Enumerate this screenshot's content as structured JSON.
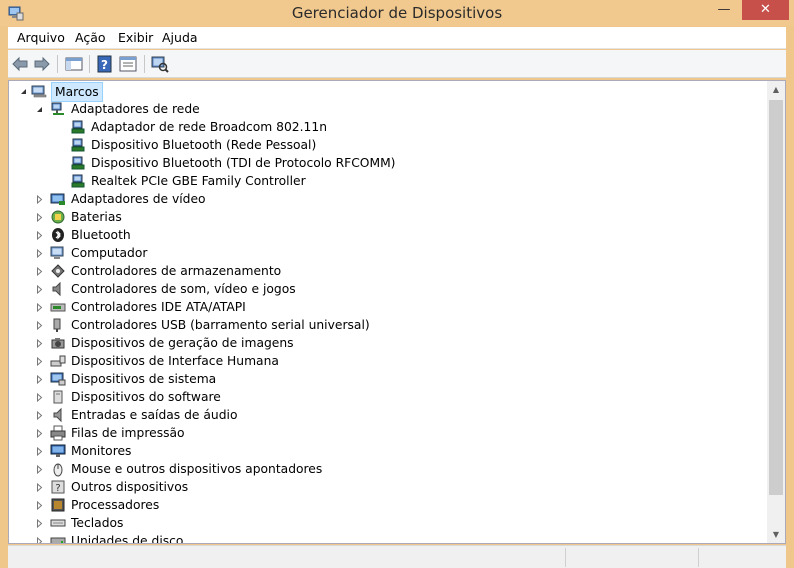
{
  "window": {
    "title": "Gerenciador de Dispositivos",
    "close_glyph": "✕",
    "minimize_glyph": "—",
    "maximize_glyph": "☐"
  },
  "menu": {
    "items": [
      {
        "label": "Arquivo",
        "name": "menu-arquivo"
      },
      {
        "label": "Ação",
        "name": "menu-acao"
      },
      {
        "label": "Exibir",
        "name": "menu-exibir"
      },
      {
        "label": "Ajuda",
        "name": "menu-ajuda"
      }
    ]
  },
  "toolbar": {
    "buttons": [
      {
        "name": "back-button",
        "icon": "arrow-left-icon"
      },
      {
        "name": "forward-button",
        "icon": "arrow-right-icon"
      },
      {
        "name": "show-hide-console-tree-button",
        "icon": "console-tree-icon"
      },
      {
        "name": "help-button",
        "icon": "help-icon"
      },
      {
        "name": "properties-button",
        "icon": "properties-icon"
      },
      {
        "name": "scan-hardware-button",
        "icon": "scan-hardware-icon"
      }
    ]
  },
  "tree": {
    "root": {
      "label": "Marcos",
      "icon": "computer-icon",
      "expanded": true
    },
    "nodes": [
      {
        "label": "Adaptadores de rede",
        "level": 1,
        "expanded": true,
        "icon": "network-icon"
      },
      {
        "label": "Adaptador de rede Broadcom 802.11n",
        "level": 2,
        "icon": "network-adapter-icon"
      },
      {
        "label": "Dispositivo Bluetooth (Rede Pessoal)",
        "level": 2,
        "icon": "network-adapter-icon"
      },
      {
        "label": "Dispositivo Bluetooth (TDI de Protocolo RFCOMM)",
        "level": 2,
        "icon": "network-adapter-icon"
      },
      {
        "label": "Realtek PCIe GBE Family Controller",
        "level": 2,
        "icon": "network-adapter-icon"
      },
      {
        "label": "Adaptadores de vídeo",
        "level": 1,
        "expanded": false,
        "icon": "display-adapter-icon"
      },
      {
        "label": "Baterias",
        "level": 1,
        "expanded": false,
        "icon": "battery-icon"
      },
      {
        "label": "Bluetooth",
        "level": 1,
        "expanded": false,
        "icon": "bluetooth-icon"
      },
      {
        "label": "Computador",
        "level": 1,
        "expanded": false,
        "icon": "computer-icon"
      },
      {
        "label": "Controladores de armazenamento",
        "level": 1,
        "expanded": false,
        "icon": "storage-controller-icon"
      },
      {
        "label": "Controladores de som, vídeo e jogos",
        "level": 1,
        "expanded": false,
        "icon": "speaker-icon"
      },
      {
        "label": "Controladores IDE ATA/ATAPI",
        "level": 1,
        "expanded": false,
        "icon": "ide-controller-icon"
      },
      {
        "label": "Controladores USB (barramento serial universal)",
        "level": 1,
        "expanded": false,
        "icon": "usb-icon"
      },
      {
        "label": "Dispositivos de geração de imagens",
        "level": 1,
        "expanded": false,
        "icon": "camera-icon"
      },
      {
        "label": "Dispositivos de Interface Humana",
        "level": 1,
        "expanded": false,
        "icon": "hid-icon"
      },
      {
        "label": "Dispositivos de sistema",
        "level": 1,
        "expanded": false,
        "icon": "system-device-icon"
      },
      {
        "label": "Dispositivos do software",
        "level": 1,
        "expanded": false,
        "icon": "software-device-icon"
      },
      {
        "label": "Entradas e saídas de áudio",
        "level": 1,
        "expanded": false,
        "icon": "audio-io-icon"
      },
      {
        "label": "Filas de impressão",
        "level": 1,
        "expanded": false,
        "icon": "printer-icon"
      },
      {
        "label": "Monitores",
        "level": 1,
        "expanded": false,
        "icon": "monitor-icon"
      },
      {
        "label": "Mouse e outros dispositivos apontadores",
        "level": 1,
        "expanded": false,
        "icon": "mouse-icon"
      },
      {
        "label": "Outros dispositivos",
        "level": 1,
        "expanded": false,
        "icon": "other-devices-icon"
      },
      {
        "label": "Processadores",
        "level": 1,
        "expanded": false,
        "icon": "processor-icon"
      },
      {
        "label": "Teclados",
        "level": 1,
        "expanded": false,
        "icon": "keyboard-icon"
      },
      {
        "label": "Unidades de disco",
        "level": 1,
        "expanded": false,
        "icon": "disk-drive-icon"
      }
    ]
  },
  "colors": {
    "titlebar": "#f1c98e",
    "close": "#c7504a",
    "selection": "#cde8ff"
  }
}
